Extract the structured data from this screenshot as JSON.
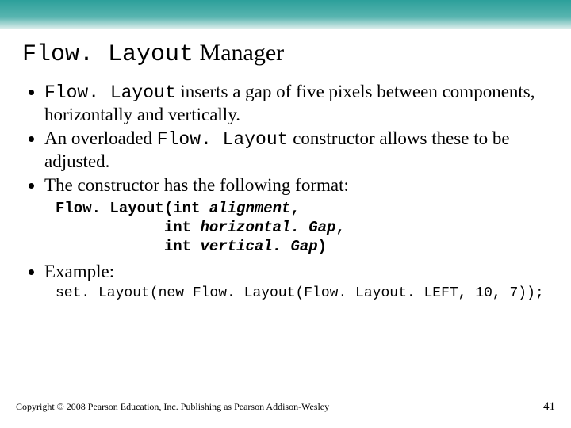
{
  "title": {
    "code": "Flow. Layout",
    "rest": " Manager"
  },
  "bullets": {
    "b1a": "Flow. Layout",
    "b1b": " inserts a gap of five pixels between components, horizontally and vertically.",
    "b2a": "An overloaded ",
    "b2b": "Flow. Layout",
    "b2c": " constructor allows these to be adjusted.",
    "b3": "The constructor has the following format:",
    "b4": "Example:"
  },
  "code": {
    "l1a": "Flow. Layout(int ",
    "l1b": "alignment",
    "l1c": ",",
    "l2a": "            int ",
    "l2b": "horizontal. Gap",
    "l2c": ",",
    "l3a": "            int ",
    "l3b": "vertical. Gap",
    "l3c": ")"
  },
  "example": "set. Layout(new Flow. Layout(Flow. Layout. LEFT, 10, 7));",
  "footer": {
    "copyright": "Copyright © 2008 Pearson Education, Inc. Publishing as Pearson Addison-Wesley",
    "page": "41"
  }
}
